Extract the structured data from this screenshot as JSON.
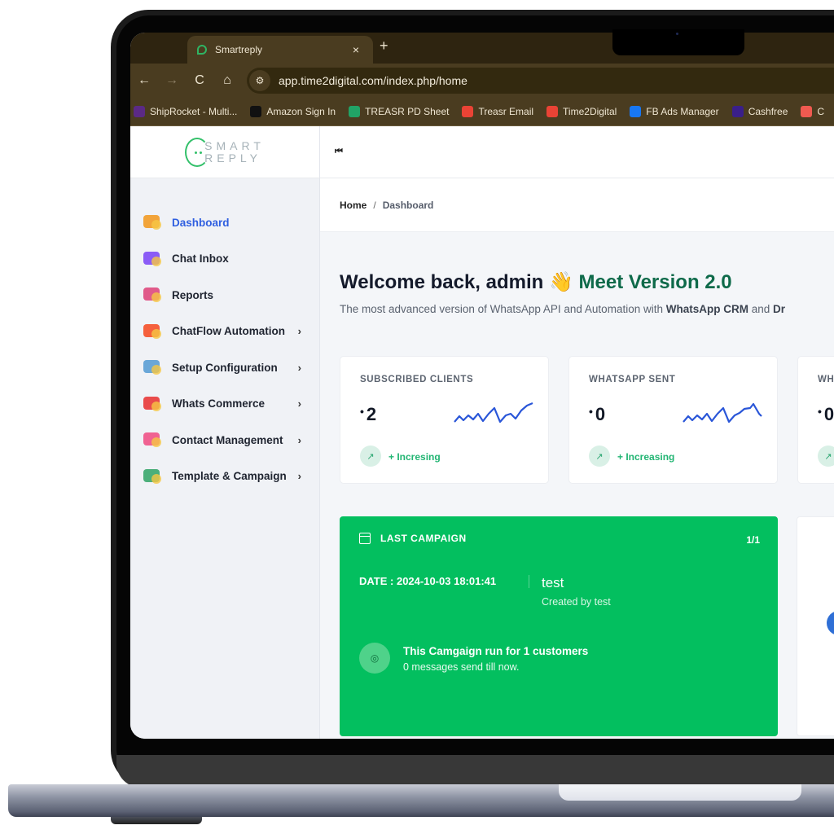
{
  "browser": {
    "tab_title": "Smartreply",
    "tab_close": "×",
    "new_tab": "+",
    "nav": {
      "back": "←",
      "forward": "→",
      "reload": "C",
      "home": "⌂"
    },
    "url_icon": "site-settings",
    "url": "app.time2digital.com/index.php/home",
    "bookmarks": [
      {
        "label": "ShipRocket - Multi...",
        "icon": "shiprocket-icon",
        "color": "#5b2a86"
      },
      {
        "label": "Amazon Sign In",
        "icon": "amazon-icon",
        "color": "#111111"
      },
      {
        "label": "TREASR PD Sheet",
        "icon": "sheets-icon",
        "color": "#21a366"
      },
      {
        "label": "Treasr Email",
        "icon": "gmail-icon",
        "color": "#ea4335"
      },
      {
        "label": "Time2Digital",
        "icon": "gmail-icon",
        "color": "#ea4335"
      },
      {
        "label": "FB Ads Manager",
        "icon": "meta-icon",
        "color": "#1877f2"
      },
      {
        "label": "Cashfree",
        "icon": "cashfree-icon",
        "color": "#3a1f8a"
      },
      {
        "label": "C",
        "icon": "ring-icon",
        "color": "#f05a50"
      }
    ]
  },
  "logo": {
    "line1": "SMART",
    "line2": "REPLY",
    "color": "#33c06a"
  },
  "sidebar": {
    "items": [
      {
        "label": "Dashboard",
        "active": true,
        "has_submenu": false,
        "icon": "dashboard-chart-icon"
      },
      {
        "label": "Chat Inbox",
        "active": false,
        "has_submenu": false,
        "icon": "chat-inbox-icon"
      },
      {
        "label": "Reports",
        "active": false,
        "has_submenu": false,
        "icon": "reports-icon"
      },
      {
        "label": "ChatFlow Automation",
        "active": false,
        "has_submenu": true,
        "icon": "chatflow-icon"
      },
      {
        "label": "Setup Configuration",
        "active": false,
        "has_submenu": true,
        "icon": "setup-monitor-icon"
      },
      {
        "label": "Whats Commerce",
        "active": false,
        "has_submenu": true,
        "icon": "store-phone-icon"
      },
      {
        "label": "Contact Management",
        "active": false,
        "has_submenu": true,
        "icon": "contacts-icon"
      },
      {
        "label": "Template & Campaign",
        "active": false,
        "has_submenu": true,
        "icon": "template-campaign-icon"
      }
    ],
    "chevron": "›"
  },
  "topbar": {
    "collapse_icon": "⏮"
  },
  "breadcrumb": {
    "home": "Home",
    "separator": "/",
    "current": "Dashboard"
  },
  "welcome": {
    "greeting": "Welcome back, admin ",
    "emoji": "👋",
    "accent": " Meet Version 2.0",
    "subtitle_prefix": "The most advanced version of WhatsApp API and Automation with ",
    "subtitle_bold1": "WhatsApp CRM",
    "subtitle_mid": " and ",
    "subtitle_bold2": "Dr"
  },
  "stats": [
    {
      "label": "SUBSCRIBED CLIENTS",
      "value": "2",
      "trend": "+ Incresing"
    },
    {
      "label": "WHATSAPP SENT",
      "value": "0",
      "trend": "+ Increasing"
    },
    {
      "label": "WH",
      "value": "0",
      "trend": ""
    }
  ],
  "campaign": {
    "header": "LAST CAMPAIGN",
    "count": "1/1",
    "date": "DATE : 2024-10-03 18:01:41",
    "name": "test",
    "created_by": "Created by test",
    "run_text": "This Camgaign run for 1 customers",
    "sent_text": "0 messages send till now.",
    "color": "#03bf5f"
  },
  "colors": {
    "primary": "#2f5fe0",
    "success": "#22b573",
    "chrome": "#4a3c20"
  }
}
